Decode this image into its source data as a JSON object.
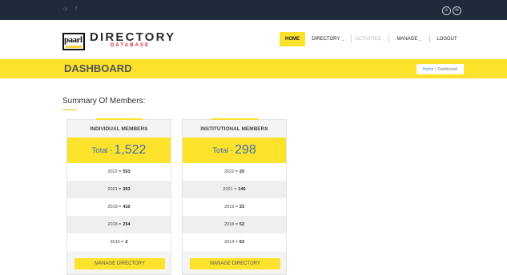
{
  "topbar": {
    "left_icons": [
      {
        "name": "skype-icon",
        "glyph": "◎"
      },
      {
        "name": "facebook-icon",
        "glyph": "f"
      }
    ],
    "right_icons": [
      {
        "name": "user-icon",
        "glyph": "♙"
      },
      {
        "name": "mail-icon",
        "glyph": "✉"
      }
    ]
  },
  "brand": {
    "logo_text": "paarl",
    "name": "DIRECTORY",
    "subname": "DATABASE"
  },
  "nav": {
    "home": "HOME",
    "directory": "DIRECTORY",
    "activities": "ACTIVITIES",
    "manage": "MANAGE",
    "logout": "LOGOUT",
    "caret": "⌄"
  },
  "banner": {
    "title": "DASHBOARD",
    "breadcrumb": {
      "home": "Home",
      "separator": "/",
      "current": "Dashboard"
    }
  },
  "summary": {
    "title": "Summary Of Members:",
    "cards": [
      {
        "heading": "INDIVIDUAL MEMBERS",
        "total_label": "Total -",
        "total_value": "1,522",
        "rows": [
          {
            "year": "2022 =",
            "count": "553"
          },
          {
            "year": "2021 =",
            "count": "303"
          },
          {
            "year": "2019 =",
            "count": "410"
          },
          {
            "year": "2018 =",
            "count": "254"
          },
          {
            "year": "2015 =",
            "count": "2"
          }
        ],
        "button": "MANAGE DIRECTORY"
      },
      {
        "heading": "INSTITUTIONAL MEMBERS",
        "total_label": "Total -",
        "total_value": "298",
        "rows": [
          {
            "year": "2022 =",
            "count": "20"
          },
          {
            "year": "2021 =",
            "count": "140"
          },
          {
            "year": "2019 =",
            "count": "23"
          },
          {
            "year": "2018 =",
            "count": "52"
          },
          {
            "year": "2014 =",
            "count": "63"
          }
        ],
        "button": "MANAGE DIRECTORY"
      }
    ]
  },
  "colors": {
    "accent": "#fde22c",
    "topbar": "#1f2a3a",
    "total_text": "#3d6fb6",
    "brand_red": "#d9262a"
  }
}
